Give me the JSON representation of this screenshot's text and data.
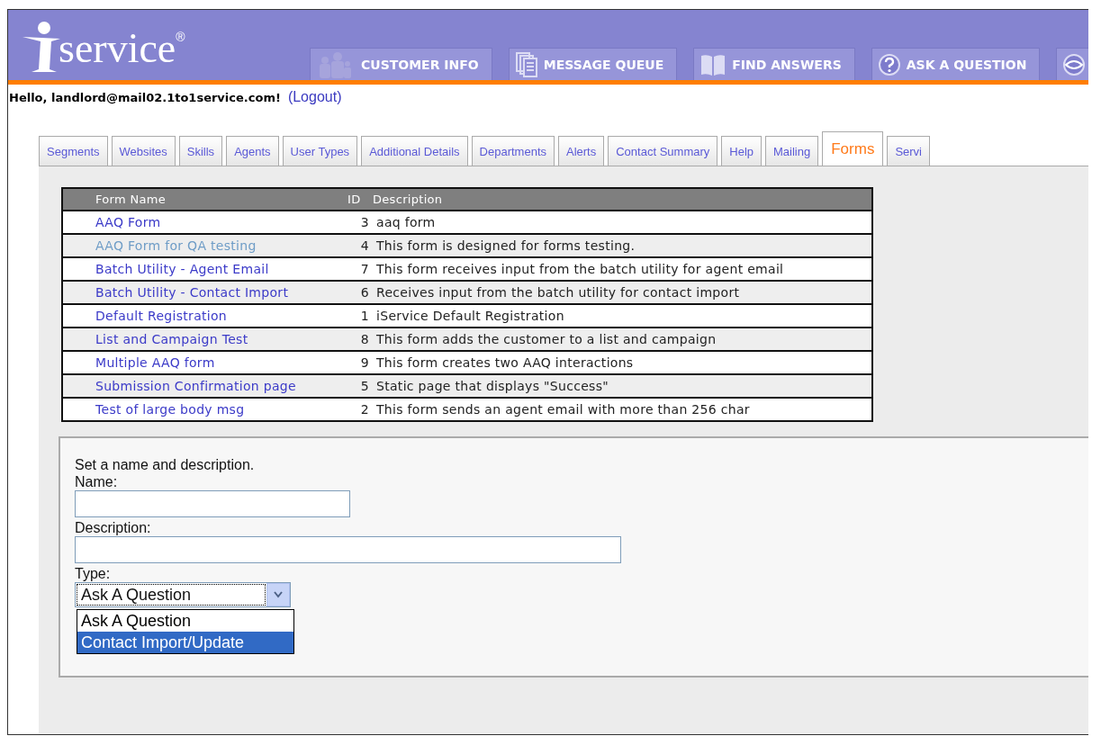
{
  "header": {
    "logo": "service",
    "registered": "®"
  },
  "nav_buttons": [
    {
      "kind": "people",
      "label": "CUSTOMER INFO"
    },
    {
      "kind": "pages",
      "label": "MESSAGE QUEUE"
    },
    {
      "kind": "book",
      "label": "FIND ANSWERS"
    },
    {
      "kind": "question",
      "label": "ASK A QUESTION"
    },
    {
      "kind": "eye"
    }
  ],
  "greeting": "Hello, landlord@mail02.1to1service.com!",
  "logout": "(Logout)",
  "tabs": [
    {
      "label": "Segments",
      "selected": false
    },
    {
      "label": "Websites",
      "selected": false
    },
    {
      "label": "Skills",
      "selected": false
    },
    {
      "label": "Agents",
      "selected": false
    },
    {
      "label": "User Types",
      "selected": false
    },
    {
      "label": "Additional Details",
      "selected": false
    },
    {
      "label": "Departments",
      "selected": false
    },
    {
      "label": "Alerts",
      "selected": false
    },
    {
      "label": "Contact Summary",
      "selected": false
    },
    {
      "label": "Help",
      "selected": false
    },
    {
      "label": "Mailing",
      "selected": false
    },
    {
      "label": "Forms",
      "selected": true
    },
    {
      "label": "Servi",
      "selected": false
    }
  ],
  "table": {
    "columns": [
      "Form Name",
      "ID",
      "Description"
    ],
    "rows": [
      {
        "name": "AAQ Form",
        "visited": false,
        "id": "3",
        "description": "aaq form"
      },
      {
        "name": "AAQ Form for QA testing",
        "visited": true,
        "id": "4",
        "description": "This form is designed for forms testing."
      },
      {
        "name": "Batch Utility - Agent Email",
        "visited": false,
        "id": "7",
        "description": "This form receives input from the batch utility for agent email"
      },
      {
        "name": "Batch Utility - Contact Import",
        "visited": false,
        "id": "6",
        "description": "Receives input from the batch utility for contact import"
      },
      {
        "name": "Default Registration",
        "visited": false,
        "id": "1",
        "description": "iService Default Registration"
      },
      {
        "name": "List and Campaign Test",
        "visited": false,
        "id": "8",
        "description": "This form adds the customer to a list and campaign"
      },
      {
        "name": "Multiple AAQ form",
        "visited": false,
        "id": "9",
        "description": "This form creates two AAQ interactions"
      },
      {
        "name": "Submission Confirmation page",
        "visited": false,
        "id": "5",
        "description": "Static page that displays \"Success\""
      },
      {
        "name": "Test of large body msg",
        "visited": false,
        "id": "2",
        "description": "This form sends an agent email with more than 256 char"
      }
    ]
  },
  "form": {
    "intro": "Set a name and description.",
    "name_label": "Name:",
    "description_label": "Description:",
    "type_label": "Type:",
    "type_value": "Ask A Question",
    "type_options": [
      {
        "label": "Ask A Question",
        "selected": false
      },
      {
        "label": "Contact Import/Update",
        "selected": true
      }
    ]
  }
}
